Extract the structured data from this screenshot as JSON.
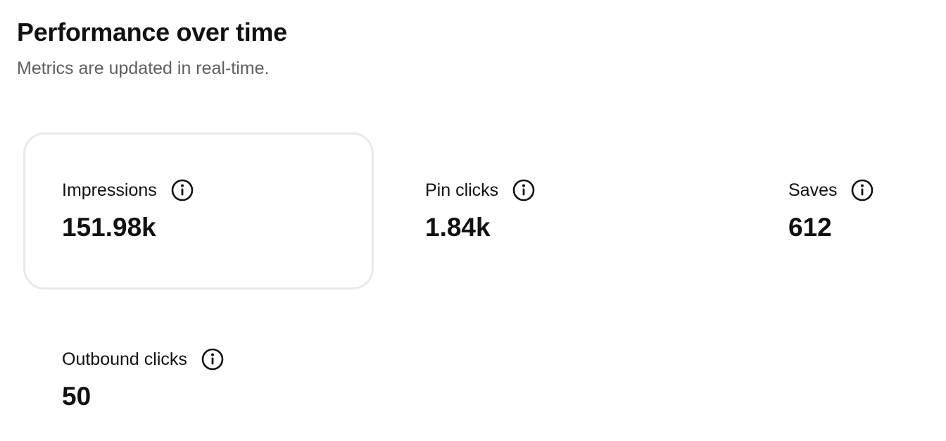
{
  "header": {
    "title": "Performance over time",
    "subtitle": "Metrics are updated in real-time."
  },
  "metrics": [
    {
      "label": "Impressions",
      "value": "151.98k",
      "selected": true,
      "info_icon": "info-circle-icon"
    },
    {
      "label": "Pin clicks",
      "value": "1.84k",
      "selected": false,
      "info_icon": "info-circle-icon"
    },
    {
      "label": "Saves",
      "value": "612",
      "selected": false,
      "info_icon": "info-circle-icon"
    },
    {
      "label": "Outbound clicks",
      "value": "50",
      "selected": false,
      "info_icon": "info-circle-icon"
    }
  ],
  "colors": {
    "text": "#111111",
    "subtext": "#5f5f5f",
    "selected_border": "#e9e9e9",
    "background": "#ffffff"
  }
}
